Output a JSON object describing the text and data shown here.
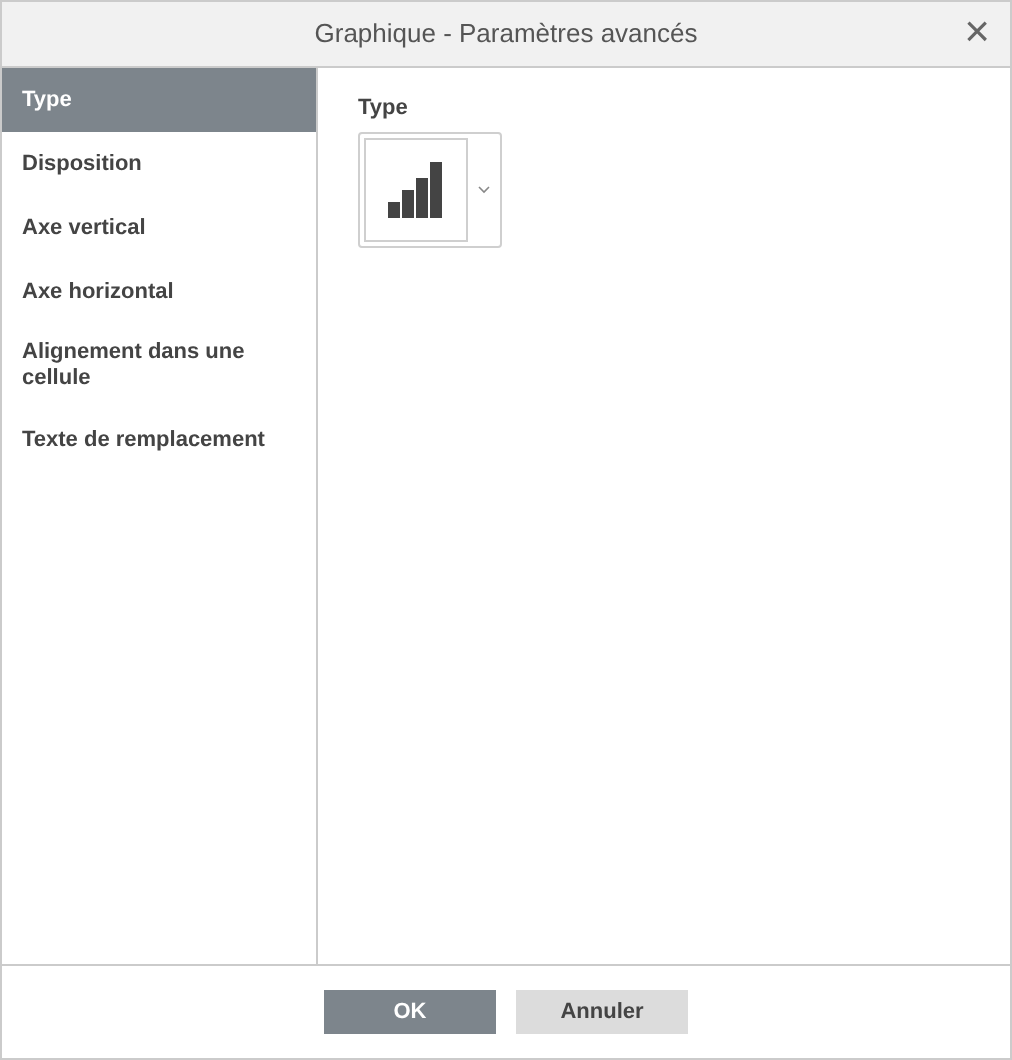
{
  "window": {
    "title": "Graphique - Paramètres avancés",
    "close": "×"
  },
  "sidebar": {
    "items": [
      {
        "label": "Type",
        "selected": true
      },
      {
        "label": "Disposition",
        "selected": false
      },
      {
        "label": "Axe vertical",
        "selected": false
      },
      {
        "label": "Axe horizontal",
        "selected": false
      },
      {
        "label": "Alignement dans une cellule",
        "selected": false
      },
      {
        "label": "Texte de remplacement",
        "selected": false
      }
    ]
  },
  "content": {
    "type_label": "Type"
  },
  "buttons": [
    {
      "label": "OK",
      "kind": "primary"
    },
    {
      "label": "Annuler",
      "kind": "secondary"
    }
  ]
}
